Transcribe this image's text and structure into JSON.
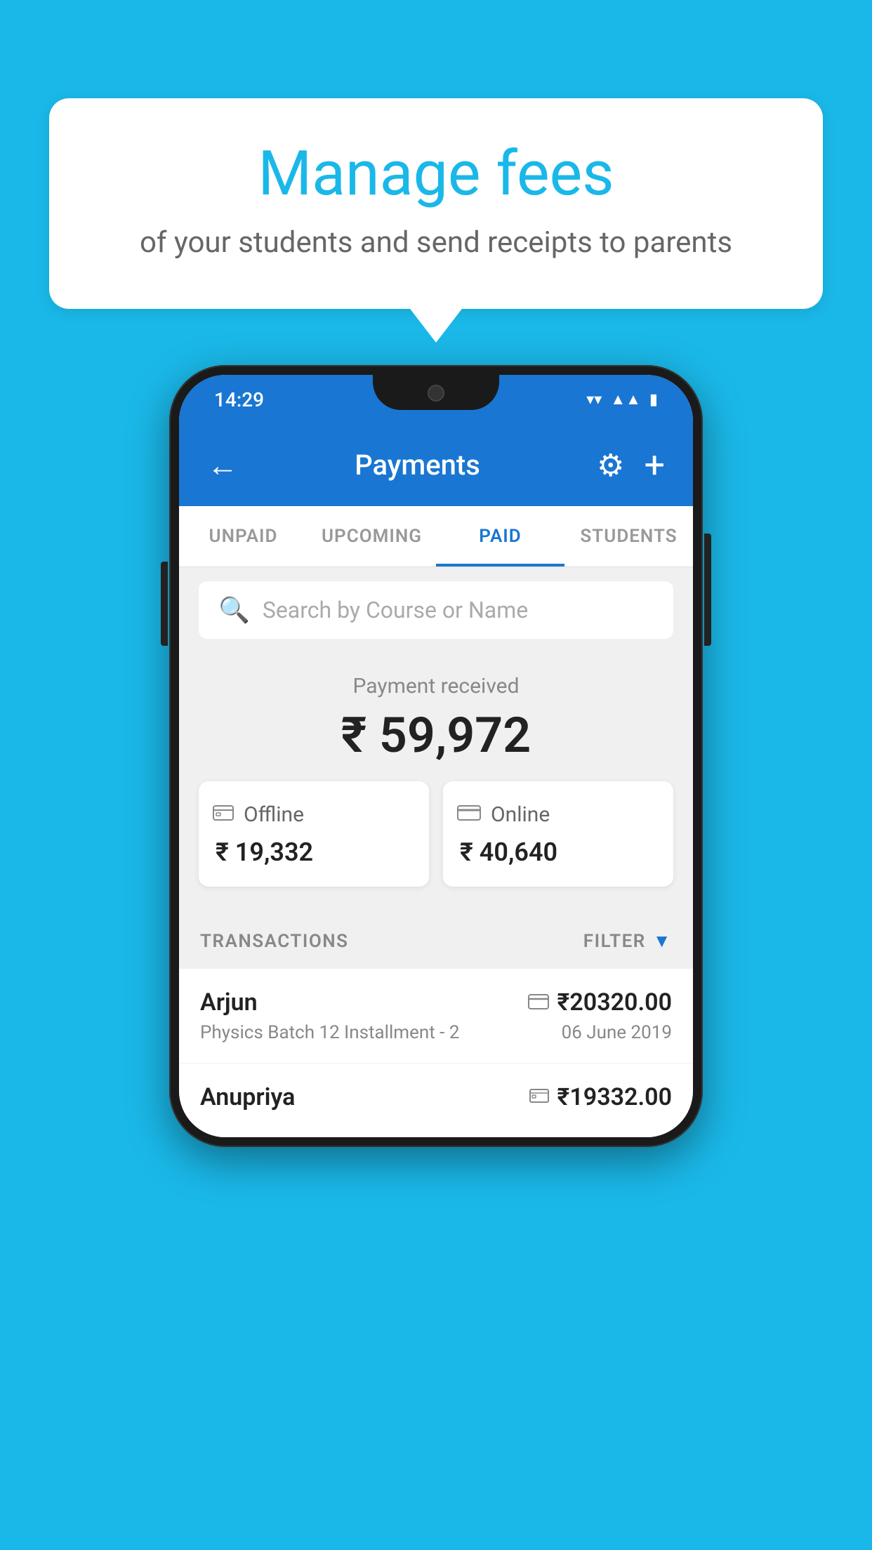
{
  "background_color": "#1ab8e8",
  "speech_bubble": {
    "title": "Manage fees",
    "subtitle": "of your students and send receipts to parents"
  },
  "status_bar": {
    "time": "14:29",
    "icons": [
      "wifi",
      "signal",
      "battery"
    ]
  },
  "app_header": {
    "title": "Payments",
    "back_label": "←",
    "settings_label": "⚙",
    "add_label": "+"
  },
  "tabs": [
    {
      "label": "UNPAID",
      "active": false
    },
    {
      "label": "UPCOMING",
      "active": false
    },
    {
      "label": "PAID",
      "active": true
    },
    {
      "label": "STUDENTS",
      "active": false
    }
  ],
  "search": {
    "placeholder": "Search by Course or Name"
  },
  "payment_summary": {
    "received_label": "Payment received",
    "total_amount": "₹ 59,972",
    "offline_label": "Offline",
    "offline_amount": "₹ 19,332",
    "online_label": "Online",
    "online_amount": "₹ 40,640"
  },
  "transactions": {
    "header_label": "TRANSACTIONS",
    "filter_label": "FILTER",
    "rows": [
      {
        "name": "Arjun",
        "payment_type": "card",
        "amount": "₹20320.00",
        "course": "Physics Batch 12 Installment - 2",
        "date": "06 June 2019"
      },
      {
        "name": "Anupriya",
        "payment_type": "cash",
        "amount": "₹19332.00",
        "course": "",
        "date": ""
      }
    ]
  }
}
